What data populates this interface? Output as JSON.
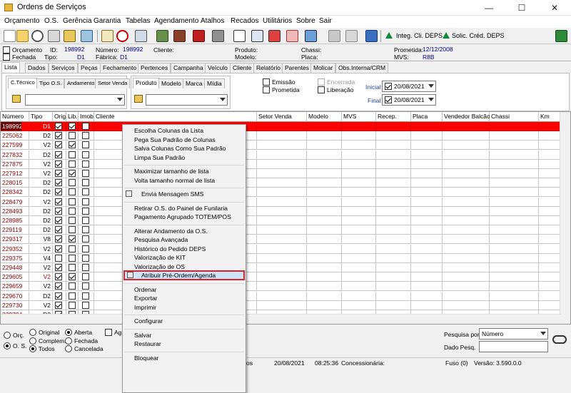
{
  "window": {
    "title": "Ordens de Serviços",
    "minimize": "—",
    "maximize": "☐",
    "close": "✕"
  },
  "menu": [
    "Orçamento",
    "O.S.",
    "Gerência",
    "Garantia",
    "Tabelas",
    "Agendamento",
    "Atalhos",
    "Recados",
    "Utilitários",
    "Sobre",
    "Sair"
  ],
  "toolbar": {
    "integ": "Integ. Cli. DEPS",
    "solic": "Solic. Créd. DEPS"
  },
  "info": {
    "orcamento": "Orçamento",
    "fechada": "Fechada",
    "id_label": "ID:",
    "id": "198992",
    "tipo_label": "Tipo:",
    "tipo": "D1",
    "numero_label": "Número:",
    "numero": "198992",
    "fabrica_label": "Fábrica:",
    "fabrica": "D1",
    "cliente_label": "Cliente:",
    "produto_label": "Produto:",
    "modelo_label": "Modelo:",
    "chassi_label": "Chassi:",
    "placa_label": "Placa:",
    "prometida_label": "Prometida:",
    "prometida": "12/12/2008",
    "mvs_label": "MVS:",
    "mvs": "R8B"
  },
  "main_tabs": [
    "Lista",
    "Dados",
    "Serviços",
    "Peças",
    "Fechamento",
    "Pertences",
    "Campanha",
    "Veículo",
    "Cliente",
    "Relatório",
    "Parentes",
    "Molicar",
    "Obs.Interna/CRM"
  ],
  "filter_tabs_a": [
    "C.Técnico",
    "Tipo O.S.",
    "Andamento",
    "Setor Venda"
  ],
  "filter_tabs_b": [
    "Produto",
    "Modelo",
    "Marca",
    "Mídia"
  ],
  "status_filters": {
    "emissao": "Emissão",
    "prometida": "Prometida",
    "encerrada": "Encerrada",
    "liberacao": "Liberação",
    "inicial": "Inicial",
    "final": "Final",
    "date_inicial": "20/08/2021",
    "date_final": "20/08/2021"
  },
  "columns": [
    "Número",
    "Tipo",
    "Orig.",
    "Lib.",
    "Imob.",
    "Cliente",
    "Setor Venda",
    "Modelo",
    "MVS",
    "Recep.",
    "Placa",
    "Vendedor Balcão",
    "Chassi",
    "Km"
  ],
  "rows": [
    {
      "num": "198992",
      "tipo": "D1",
      "orig": true,
      "lib": true,
      "imob": false
    },
    {
      "num": "225062",
      "tipo": "D2",
      "orig": true,
      "lib": false,
      "imob": false
    },
    {
      "num": "227599",
      "tipo": "V2",
      "orig": true,
      "lib": true,
      "imob": false
    },
    {
      "num": "227832",
      "tipo": "D2",
      "orig": true,
      "lib": false,
      "imob": false
    },
    {
      "num": "227875",
      "tipo": "V2",
      "orig": true,
      "lib": false,
      "imob": false
    },
    {
      "num": "227912",
      "tipo": "V2",
      "orig": true,
      "lib": true,
      "imob": false
    },
    {
      "num": "228015",
      "tipo": "D2",
      "orig": true,
      "lib": false,
      "imob": false
    },
    {
      "num": "228342",
      "tipo": "D2",
      "orig": true,
      "lib": false,
      "imob": false
    },
    {
      "num": "228479",
      "tipo": "V2",
      "orig": true,
      "lib": false,
      "imob": false
    },
    {
      "num": "228493",
      "tipo": "D2",
      "orig": true,
      "lib": false,
      "imob": false
    },
    {
      "num": "228985",
      "tipo": "D2",
      "orig": true,
      "lib": false,
      "imob": false
    },
    {
      "num": "229119",
      "tipo": "D2",
      "orig": true,
      "lib": false,
      "imob": false
    },
    {
      "num": "229317",
      "tipo": "V8",
      "orig": true,
      "lib": true,
      "imob": false
    },
    {
      "num": "229352",
      "tipo": "V2",
      "orig": true,
      "lib": false,
      "imob": false
    },
    {
      "num": "229375",
      "tipo": "V4",
      "orig": false,
      "lib": false,
      "imob": false
    },
    {
      "num": "229448",
      "tipo": "V2",
      "orig": true,
      "lib": false,
      "imob": false
    },
    {
      "num": "229605",
      "tipo": "V2",
      "orig": true,
      "lib": true,
      "imob": false
    },
    {
      "num": "229659",
      "tipo": "V2",
      "orig": true,
      "lib": false,
      "imob": false
    },
    {
      "num": "229670",
      "tipo": "D2",
      "orig": true,
      "lib": false,
      "imob": false
    },
    {
      "num": "229730",
      "tipo": "V2",
      "orig": true,
      "lib": false,
      "imob": false
    },
    {
      "num": "229794",
      "tipo": "D2",
      "orig": true,
      "lib": false,
      "imob": false
    }
  ],
  "context_menu": [
    {
      "label": "Escolha Colunas da Lista"
    },
    {
      "label": "Pega Sua Padrão de Colunas"
    },
    {
      "label": "Salva Colunas Como Sua Padrão"
    },
    {
      "label": "Limpa Sua Padrão"
    },
    {
      "sep": true
    },
    {
      "label": "Maximizar tamanho de lista"
    },
    {
      "label": "Volta tamanho normal de lista"
    },
    {
      "sep": true
    },
    {
      "label": "Envia Mensagem SMS",
      "icon": true
    },
    {
      "sep": true
    },
    {
      "label": "Retirar O.S. do Painel de Funilaria"
    },
    {
      "label": "Pagamento Agrupado TOTEM/POS"
    },
    {
      "sep": true
    },
    {
      "label": "Alterar Andamento da O.S."
    },
    {
      "label": "Pesquisa Avançada"
    },
    {
      "label": "Histórico do Pedido DEPS"
    },
    {
      "label": "Valorização de KIT"
    },
    {
      "label": "Valorização de OS"
    },
    {
      "label": "Atribuir Pré-Ordem/Agenda",
      "highlight": true,
      "icon": true
    },
    {
      "sep": true
    },
    {
      "label": "Ordenar"
    },
    {
      "label": "Exportar"
    },
    {
      "label": "Imprimir"
    },
    {
      "sep": true
    },
    {
      "label": "Configurar"
    },
    {
      "sep": true
    },
    {
      "label": "Salvar"
    },
    {
      "label": "Restaurar"
    },
    {
      "sep": true
    },
    {
      "label": "Bloquear"
    }
  ],
  "bottom": {
    "orc": "Orç.",
    "os": "O. S.",
    "original": "Original",
    "complem": "Complem.",
    "todos": "Todos",
    "aberta": "Aberta",
    "fechada": "Fechada",
    "cancelada": "Cancelada",
    "ag": "Ag",
    "pesquisa_por": "Pesquisa por",
    "pesquisa_value": "Número",
    "dado_pesq": "Dado Pesq."
  },
  "status": {
    "os": "os",
    "date": "20/08/2021",
    "time": "08:25:36",
    "concessionaria": "Concessionária:",
    "fuso": "Fuso (0)",
    "versao": "Versão: 3.590.0.0"
  }
}
